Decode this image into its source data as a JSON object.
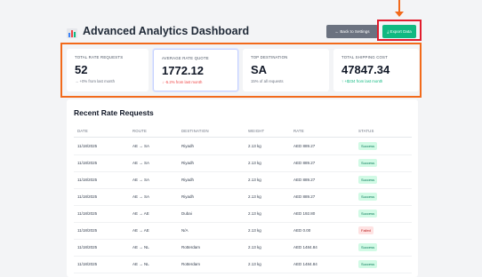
{
  "header": {
    "title": "Advanced Analytics Dashboard",
    "back_label": "← Back to Settings",
    "export_label": "⤓ Export Data"
  },
  "stats": [
    {
      "label": "TOTAL RATE REQUESTS",
      "value": "52",
      "sub": "→ +0% from last month",
      "tone": "neutral"
    },
    {
      "label": "AVERAGE RATE QUOTE",
      "value": "1772.12",
      "sub": "↓ -5.2% from last month",
      "tone": "red"
    },
    {
      "label": "TOP DESTINATION",
      "value": "SA",
      "sub": "15% of all requests",
      "tone": "neutral"
    },
    {
      "label": "TOTAL SHIPPING COST",
      "value": "47847.34",
      "sub": "↑ +$234 from last month",
      "tone": "green"
    }
  ],
  "table": {
    "title": "Recent Rate Requests",
    "columns": [
      "DATE",
      "ROUTE",
      "DESTINATION",
      "WEIGHT",
      "RATE",
      "STATUS"
    ],
    "rows": [
      {
        "date": "11/18/2025",
        "route": "AE → SA",
        "destination": "Riyadh",
        "weight": "2.13 kg",
        "rate": "AED 889.27",
        "status": "Success"
      },
      {
        "date": "11/18/2025",
        "route": "AE → SA",
        "destination": "Riyadh",
        "weight": "2.13 kg",
        "rate": "AED 889.27",
        "status": "Success"
      },
      {
        "date": "11/18/2025",
        "route": "AE → SA",
        "destination": "Riyadh",
        "weight": "2.13 kg",
        "rate": "AED 889.27",
        "status": "Success"
      },
      {
        "date": "11/18/2025",
        "route": "AE → SA",
        "destination": "Riyadh",
        "weight": "2.13 kg",
        "rate": "AED 889.27",
        "status": "Success"
      },
      {
        "date": "11/18/2025",
        "route": "AE → AE",
        "destination": "Dubai",
        "weight": "2.13 kg",
        "rate": "AED 192.80",
        "status": "Success"
      },
      {
        "date": "11/18/2025",
        "route": "AE → AE",
        "destination": "N/A",
        "weight": "2.13 kg",
        "rate": "AED 0.00",
        "status": "Failed"
      },
      {
        "date": "11/18/2025",
        "route": "AE → NL",
        "destination": "Rotterdam",
        "weight": "2.13 kg",
        "rate": "AED 1484.84",
        "status": "Success"
      },
      {
        "date": "11/18/2025",
        "route": "AE → NL",
        "destination": "Rotterdam",
        "weight": "2.13 kg",
        "rate": "AED 1484.84",
        "status": "Success"
      }
    ]
  },
  "colors": {
    "highlight_red": "#e11d2e",
    "highlight_orange": "#f26a1b",
    "export_green": "#10b981",
    "back_gray": "#6b7280"
  }
}
